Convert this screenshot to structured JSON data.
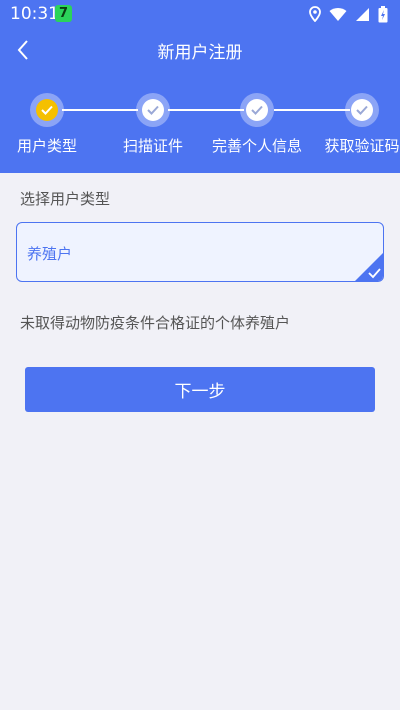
{
  "status_bar": {
    "time": "10:31",
    "app_badge": "7"
  },
  "nav": {
    "title": "新用户注册"
  },
  "steps": [
    {
      "label": "用户类型",
      "state": "current"
    },
    {
      "label": "扫描证件",
      "state": "pending"
    },
    {
      "label": "完善个人信息",
      "state": "pending"
    },
    {
      "label": "获取验证码",
      "state": "pending"
    }
  ],
  "form": {
    "section_label": "选择用户类型",
    "selected_type": "养殖户",
    "description": "未取得动物防疫条件合格证的个体养殖户"
  },
  "actions": {
    "next_label": "下一步"
  },
  "colors": {
    "primary": "#4d74f1",
    "active_step": "#f5c000",
    "background": "#f1f1f7"
  }
}
